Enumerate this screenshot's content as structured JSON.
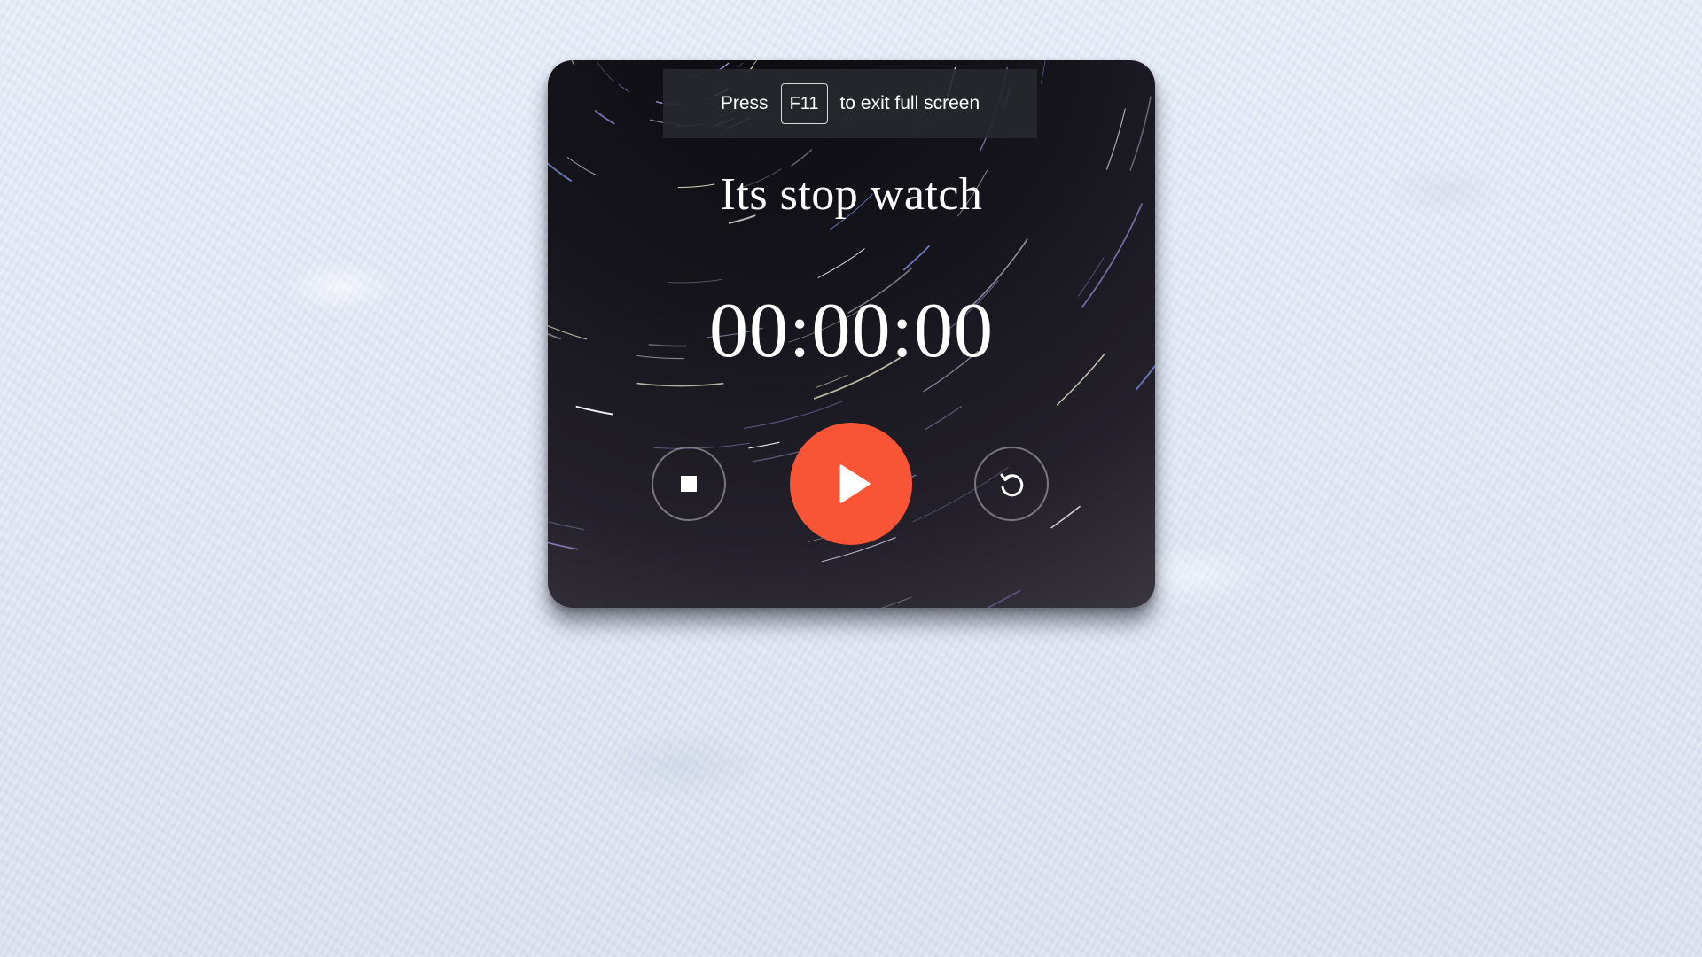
{
  "fullscreen_notice": {
    "prefix": "Press",
    "key": "F11",
    "suffix": "to exit full screen"
  },
  "stopwatch": {
    "title": "Its stop watch",
    "time": "00:00:00"
  },
  "controls": {
    "stop_icon": "stop-icon",
    "play_icon": "play-icon",
    "reset_icon": "reset-icon",
    "play_color": "#fa5437"
  }
}
